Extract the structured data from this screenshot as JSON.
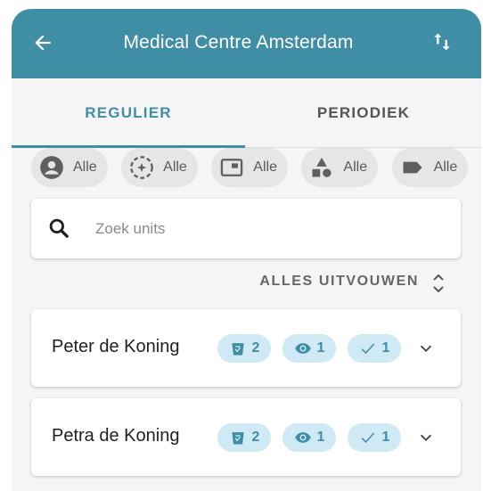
{
  "appbar": {
    "title": "Medical Centre Amsterdam",
    "back_icon": "arrow-left-icon",
    "sort_icon": "sort-arrows-icon"
  },
  "colors": {
    "primary": "#3f8ea5",
    "badge_bg": "#cfeaf5",
    "chip_bg": "#e6e6e6",
    "background": "#f5f5f5"
  },
  "tabs": [
    {
      "label": "REGULIER",
      "active": true
    },
    {
      "label": "PERIODIEK",
      "active": false
    }
  ],
  "filters": [
    {
      "icon": "person-icon",
      "label": "Alle"
    },
    {
      "icon": "recycle-icon",
      "label": "Alle"
    },
    {
      "icon": "screen-icon",
      "label": "Alle"
    },
    {
      "icon": "shapes-icon",
      "label": "Alle"
    },
    {
      "icon": "tag-icon",
      "label": "Alle"
    }
  ],
  "search": {
    "placeholder": "Zoek units",
    "value": ""
  },
  "expand_all": {
    "label": "ALLES UITVOUWEN"
  },
  "units": [
    {
      "name": "Peter de Koning",
      "badges": [
        {
          "icon": "bin-icon",
          "count": "2"
        },
        {
          "icon": "eye-icon",
          "count": "1"
        },
        {
          "icon": "check-icon",
          "count": "1"
        }
      ]
    },
    {
      "name": "Petra de Koning",
      "badges": [
        {
          "icon": "bin-icon",
          "count": "2"
        },
        {
          "icon": "eye-icon",
          "count": "1"
        },
        {
          "icon": "check-icon",
          "count": "1"
        }
      ]
    }
  ]
}
